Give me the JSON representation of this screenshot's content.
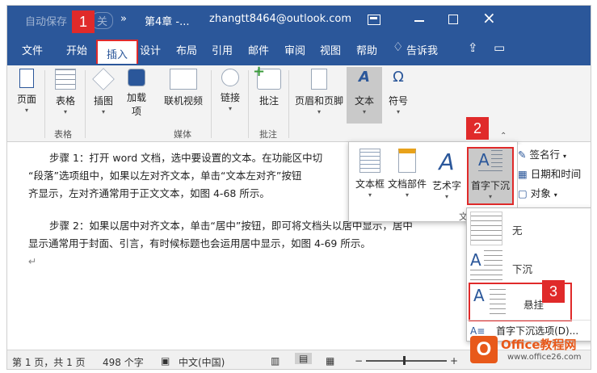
{
  "title_bar": {
    "autosave": "自动保存",
    "autosave_state": "关",
    "more": "»",
    "doc_title": "第4章 -...",
    "account": "zhangtt8464@outlook.com"
  },
  "menu": {
    "tabs": [
      "文件",
      "开始",
      "插入",
      "设计",
      "布局",
      "引用",
      "邮件",
      "审阅",
      "视图",
      "帮助"
    ],
    "tell": "告诉我",
    "active": "插入"
  },
  "ribbon": {
    "page": "页面",
    "table": "表格",
    "illustrations": "插图",
    "addins_1": "加载",
    "addins_2": "项",
    "online_video": "联机视频",
    "link": "链接",
    "comment": "批注",
    "header_footer": "页眉和页脚",
    "text": "文本",
    "symbols": "符号",
    "group_table": "表格",
    "group_media": "媒体",
    "group_comment": "批注"
  },
  "text_panel": {
    "textbox": "文本框",
    "quickparts": "文档部件",
    "wordart": "艺术字",
    "dropcap": "首字下沉",
    "signature": "签名行",
    "datetime": "日期和时间",
    "object": "对象",
    "group_label": "文"
  },
  "dropcap_menu": {
    "none": "无",
    "dropped": "下沉",
    "in_margin": "悬挂",
    "options": "首字下沉选项(D)..."
  },
  "document": {
    "step1_line1": "步骤 1：打开 word 文档，选中要设置的文本。在功能区中切",
    "step1_line2": "“段落”选项组中，如果以左对齐文本，单击“文本左对齐”按钮",
    "step1_line3": "齐显示，左对齐通常用于正文文本，如图 4-68 所示。",
    "step2_line1": "步骤 2：如果以居中对齐文本，单击“居中”按钮，即可将文档头以居中显示，居中",
    "step2_line2": "显示通常用于封面、引言，有时候标题也会运用居中显示，如图 4-69 所示。",
    "para_mark": "↵"
  },
  "status": {
    "page": "第 1 页，共 1 页",
    "words": "498 个字",
    "lang": "中文(中国)",
    "zoom_minus": "−",
    "zoom_plus": "+"
  },
  "badges": {
    "b1": "1",
    "b2": "2",
    "b3": "3"
  },
  "watermark": {
    "site": "Office教程网",
    "url": "www.office26.com"
  },
  "colors": {
    "word_blue": "#2b579a",
    "highlight_red": "#e02a2a",
    "ribbon_bg": "#f3f3f3",
    "selected_gray": "#c9c9c9"
  }
}
